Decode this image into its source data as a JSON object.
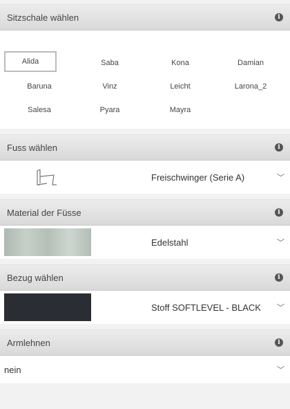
{
  "sections": {
    "seat": {
      "title": "Sitzschale wählen",
      "options": [
        "Alida",
        "Saba",
        "Kona",
        "Damian",
        "Baruna",
        "Vinz",
        "Leicht",
        "Larona_2",
        "Salesa",
        "Pyara",
        "Mayra"
      ],
      "selected": "Alida"
    },
    "foot": {
      "title": "Fuss wählen",
      "value": "Freischwinger (Serie A)"
    },
    "material": {
      "title": "Material der Füsse",
      "value": "Edelstahl",
      "swatch_color": "#b9c4bd"
    },
    "cover": {
      "title": "Bezug wählen",
      "value": "Stoff SOFTLEVEL - BLACK",
      "swatch_color": "#2a2d33"
    },
    "armrest": {
      "title": "Armlehnen",
      "value": "nein"
    }
  },
  "icons": {
    "info": "i",
    "chevron": "﹀"
  }
}
